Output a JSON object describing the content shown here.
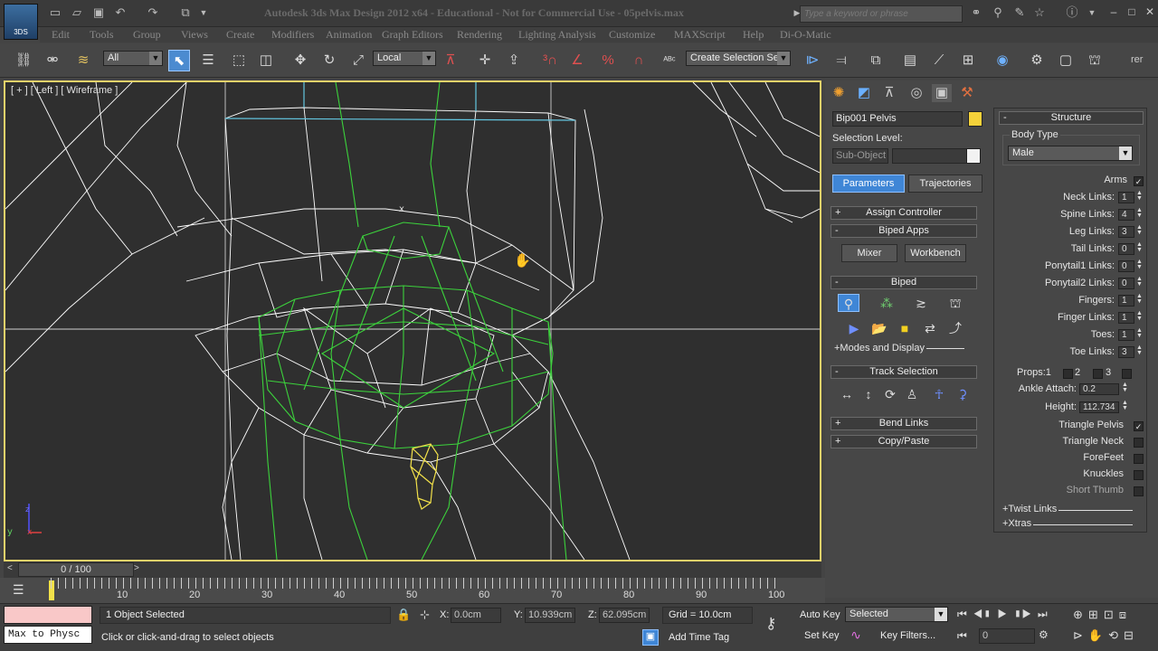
{
  "app": {
    "title": "Autodesk 3ds Max Design 2012 x64 - Educational - Not for Commercial Use - 05pelvis.max",
    "logo_text": "3DS",
    "search_placeholder": "Type a keyword or phrase"
  },
  "menu": [
    "Edit",
    "Tools",
    "Group",
    "Views",
    "Create",
    "Modifiers",
    "Animation",
    "Graph Editors",
    "Rendering",
    "Lighting Analysis",
    "Customize",
    "MAXScript",
    "Help",
    "Di-O-Matic"
  ],
  "toolbar": {
    "selection_filter": "All",
    "ref_coord": "Local",
    "selection_set": "Create Selection Set",
    "right_label": "rer"
  },
  "viewport": {
    "label": "[ + ] [ Left ] [ Wireframe ]",
    "gizmo_label": "x",
    "axis_y": "y",
    "axis_z": "z",
    "axis_x": "x"
  },
  "panel": {
    "object_name": "Bip001 Pelvis",
    "object_color": "#f5d23a",
    "selection_level_label": "Selection Level:",
    "sub_object": "Sub-Object",
    "parameters_tab": "Parameters",
    "trajectories_tab": "Trajectories",
    "assign_controller": "Assign Controller",
    "biped_apps": "Biped Apps",
    "mixer": "Mixer",
    "workbench": "Workbench",
    "biped": "Biped",
    "modes_display": "+Modes and Display",
    "track_selection": "Track Selection",
    "bend_links": "Bend Links",
    "copy_paste": "Copy/Paste"
  },
  "structure": {
    "title": "Structure",
    "body_type_label": "Body Type",
    "body_type": "Male",
    "rows": [
      {
        "label": "Arms",
        "kind": "check",
        "checked": true
      },
      {
        "label": "Neck Links:",
        "kind": "spin",
        "value": "1"
      },
      {
        "label": "Spine Links:",
        "kind": "spin",
        "value": "4"
      },
      {
        "label": "Leg Links:",
        "kind": "spin",
        "value": "3"
      },
      {
        "label": "Tail Links:",
        "kind": "spin",
        "value": "0"
      },
      {
        "label": "Ponytail1 Links:",
        "kind": "spin",
        "value": "0"
      },
      {
        "label": "Ponytail2 Links:",
        "kind": "spin",
        "value": "0"
      },
      {
        "label": "Fingers:",
        "kind": "spin",
        "value": "1"
      },
      {
        "label": "Finger Links:",
        "kind": "spin",
        "value": "1"
      },
      {
        "label": "Toes:",
        "kind": "spin",
        "value": "1"
      },
      {
        "label": "Toe Links:",
        "kind": "spin",
        "value": "3"
      }
    ],
    "props_label": "Props:",
    "props": [
      "1",
      "2",
      "3"
    ],
    "ankle_label": "Ankle Attach:",
    "ankle_value": "0.2",
    "height_label": "Height:",
    "height_value": "112.734",
    "checks": [
      {
        "label": "Triangle Pelvis",
        "checked": true
      },
      {
        "label": "Triangle Neck",
        "checked": false
      },
      {
        "label": "ForeFeet",
        "checked": false
      },
      {
        "label": "Knuckles",
        "checked": false
      },
      {
        "label": "Short Thumb",
        "checked": false
      }
    ],
    "twist_links": "+Twist Links",
    "xtras": "+Xtras"
  },
  "timeline": {
    "frame": "0 / 100",
    "ticks": [
      "10",
      "20",
      "30",
      "40",
      "50",
      "60",
      "70",
      "80",
      "90",
      "100"
    ]
  },
  "status": {
    "maxscript": "Max to Physc",
    "selected": "1 Object Selected",
    "prompt": "Click or click-and-drag to select objects",
    "x_label": "X:",
    "x": "0.0cm",
    "y_label": "Y:",
    "y": "10.939cm",
    "z_label": "Z:",
    "z": "62.095cm",
    "grid": "Grid = 10.0cm",
    "add_time_tag": "Add Time Tag",
    "auto_key": "Auto Key",
    "set_key": "Set Key",
    "key_mode": "Selected",
    "key_filters": "Key Filters...",
    "current_frame": "0"
  }
}
